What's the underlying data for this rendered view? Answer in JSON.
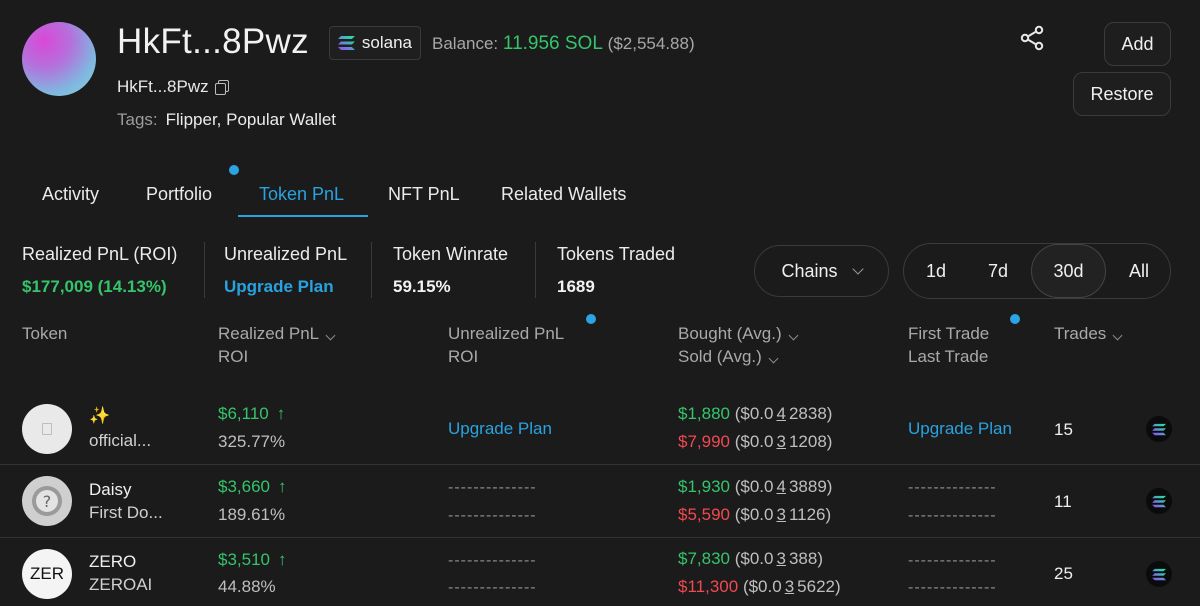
{
  "header": {
    "wallet_name": "HkFt...8Pwz",
    "chain_label": "solana",
    "balance_label": "Balance:",
    "balance_sol": "11.956 SOL",
    "balance_usd": "($2,554.88)",
    "wallet_address": "HkFt...8Pwz",
    "tags_label": "Tags:",
    "tags_value": "Flipper, Popular Wallet",
    "add_label": "Add",
    "restore_label": "Restore"
  },
  "tabs": [
    {
      "label": "Activity"
    },
    {
      "label": "Portfolio"
    },
    {
      "label": "Token PnL"
    },
    {
      "label": "NFT PnL"
    },
    {
      "label": "Related Wallets"
    }
  ],
  "active_tab": "Token PnL",
  "stats": {
    "realized_label": "Realized PnL (ROI)",
    "realized_value": "$177,009 (14.13%)",
    "unrealized_label": "Unrealized PnL",
    "unrealized_value": "Upgrade Plan",
    "winrate_label": "Token Winrate",
    "winrate_value": "59.15%",
    "traded_label": "Tokens Traded",
    "traded_value": "1689"
  },
  "filters": {
    "chains_label": "Chains",
    "ranges": [
      "1d",
      "7d",
      "30d",
      "All"
    ],
    "active_range": "30d"
  },
  "table": {
    "headers": {
      "token": "Token",
      "realized": "Realized PnL",
      "realized_roi": "ROI",
      "unrealized": "Unrealized PnL",
      "unrealized_roi": "ROI",
      "bought": "Bought (Avg.)",
      "sold": "Sold (Avg.)",
      "first_trade": "First Trade",
      "last_trade": "Last Trade",
      "trades": "Trades"
    },
    "rows": [
      {
        "name": "✨",
        "sub": "official...",
        "realized": "$6,110",
        "roi": "325.77%",
        "unrealized": "Upgrade Plan",
        "unrealized_roi": "",
        "bought_usd": "$1,880",
        "bought_avg_prefix": "($0.0",
        "bought_avg_zeros": "4",
        "bought_avg_rest": "2838)",
        "sold_usd": "$7,990",
        "sold_avg_prefix": "($0.0",
        "sold_avg_zeros": "3",
        "sold_avg_rest": "1208)",
        "first_trade": "Upgrade Plan",
        "last_trade": "",
        "trades": "15",
        "chain_icon": "solana-icon"
      },
      {
        "name": "Daisy",
        "sub": "First Do...",
        "realized": "$3,660",
        "roi": "189.61%",
        "unrealized": "--------------",
        "unrealized_roi": "--------------",
        "bought_usd": "$1,930",
        "bought_avg_prefix": "($0.0",
        "bought_avg_zeros": "4",
        "bought_avg_rest": "3889)",
        "sold_usd": "$5,590",
        "sold_avg_prefix": "($0.0",
        "sold_avg_zeros": "3",
        "sold_avg_rest": "1126)",
        "first_trade": "--------------",
        "last_trade": "--------------",
        "trades": "11",
        "chain_icon": "solana-icon"
      },
      {
        "name": "ZERO",
        "sub": "ZEROAI",
        "logo_text": "ZER",
        "realized": "$3,510",
        "roi": "44.88%",
        "unrealized": "--------------",
        "unrealized_roi": "--------------",
        "bought_usd": "$7,830",
        "bought_avg_prefix": "($0.0",
        "bought_avg_zeros": "3",
        "bought_avg_rest": "388)",
        "sold_usd": "$11,300",
        "sold_avg_prefix": "($0.0",
        "sold_avg_zeros": "3",
        "sold_avg_rest": "5622)",
        "first_trade": "--------------",
        "last_trade": "--------------",
        "trades": "25",
        "chain_icon": "solana-icon"
      }
    ]
  },
  "colors": {
    "background": "#1b1b1b",
    "accent_blue": "#29a3e0",
    "profit_green": "#35c46b",
    "loss_red": "#f0494f"
  }
}
